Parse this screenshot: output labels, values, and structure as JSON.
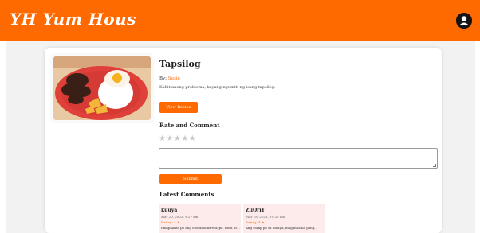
{
  "header": {
    "brand": "YH Yum Hous",
    "brand_color": "#ff6a00",
    "profile_icon": "profile-icon"
  },
  "recipe": {
    "image_icon": "food-photo-tapsilog",
    "title": "Tapsilog",
    "by_label": "By:",
    "author": "Susie",
    "description": "Kahit anong problema, kayang ngumiti ng isang tapsilog.",
    "view_button": "View Recipe"
  },
  "rating": {
    "section_title": "Rate and Comment",
    "stars": "★★★★★",
    "comment_placeholder": "",
    "submit_button": "Submit"
  },
  "comments": {
    "section_title": "Latest Comments",
    "items": [
      {
        "name": "kuuya",
        "date": "Mar 20, 2023, 9:27 am",
        "rating": "Rating: 4 ★",
        "text": "Pinapalkita po ang ekotamdanrecarpo. Bera  lit..."
      },
      {
        "name": "ZiiOriY",
        "date": "Mar 18, 2023, 10:25 am",
        "rating": "Rating: 4 ★",
        "text": "Ang sarap po sa umaga, maganda na pang..."
      }
    ]
  }
}
